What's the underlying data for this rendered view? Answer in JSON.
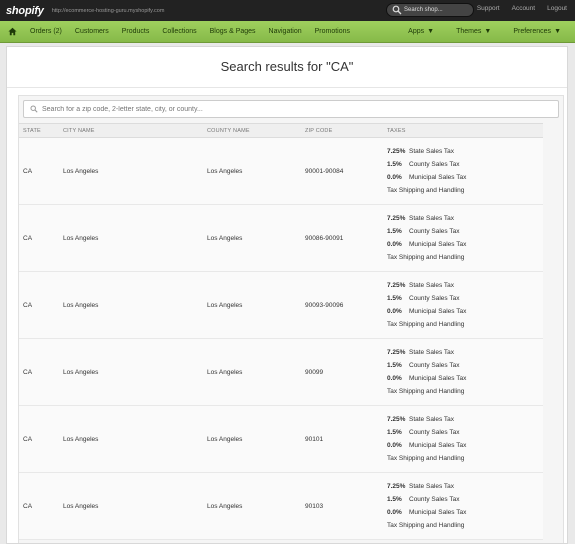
{
  "topbar": {
    "logo": "shopify",
    "store_url": "http://ecommerce-hosting-guru.myshopify.com",
    "search_placeholder": "Search shop...",
    "links": [
      "Support",
      "Account",
      "Logout"
    ]
  },
  "nav": {
    "items": [
      "Orders (2)",
      "Customers",
      "Products",
      "Collections",
      "Blogs & Pages",
      "Navigation",
      "Promotions"
    ],
    "right": [
      "Apps",
      "Themes",
      "Preferences"
    ]
  },
  "page": {
    "title": "Search results for \"CA\"",
    "search_placeholder": "Search for a zip code, 2-letter state, city, or county..."
  },
  "table": {
    "headers": [
      "STATE",
      "CITY NAME",
      "COUNTY NAME",
      "ZIP CODE",
      "TAXES"
    ],
    "tax_lines": [
      {
        "rate": "7.25%",
        "label": "State Sales Tax"
      },
      {
        "rate": "1.5%",
        "label": "County Sales Tax"
      },
      {
        "rate": "0.0%",
        "label": "Municipal Sales Tax"
      }
    ],
    "shipping_note": "Tax Shipping and Handling",
    "rows": [
      {
        "state": "CA",
        "city": "Los Angeles",
        "county": "Los Angeles",
        "zip": "90001-90084"
      },
      {
        "state": "CA",
        "city": "Los Angeles",
        "county": "Los Angeles",
        "zip": "90086-90091"
      },
      {
        "state": "CA",
        "city": "Los Angeles",
        "county": "Los Angeles",
        "zip": "90093-90096"
      },
      {
        "state": "CA",
        "city": "Los Angeles",
        "county": "Los Angeles",
        "zip": "90099"
      },
      {
        "state": "CA",
        "city": "Los Angeles",
        "county": "Los Angeles",
        "zip": "90101"
      },
      {
        "state": "CA",
        "city": "Los Angeles",
        "county": "Los Angeles",
        "zip": "90103"
      }
    ]
  }
}
